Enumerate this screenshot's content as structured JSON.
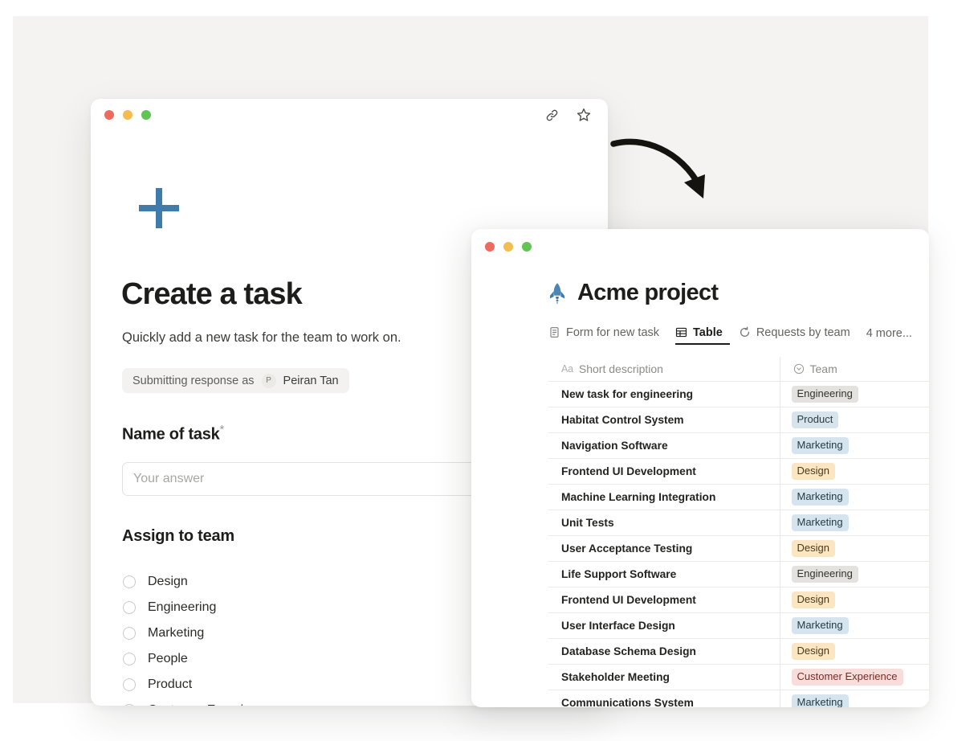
{
  "form_window": {
    "traffic_lights": [
      "close",
      "minimize",
      "maximize"
    ],
    "actions": [
      {
        "name": "link-icon",
        "label": "Copy link"
      },
      {
        "name": "star-icon",
        "label": "Favorite"
      }
    ],
    "plus_label": "+",
    "title": "Create a task",
    "subtitle": "Quickly add a new task for the team to work on.",
    "submitting": {
      "prefix": "Submitting response as",
      "avatar_initial": "P",
      "user_name": "Peiran Tan"
    },
    "fields": [
      {
        "label": "Name of task",
        "required_mark": "*",
        "input_placeholder": "Your answer",
        "input_value": ""
      },
      {
        "label": "Assign to team",
        "required_mark": "",
        "options": [
          "Design",
          "Engineering",
          "Marketing",
          "People",
          "Product",
          "Customer Experience"
        ]
      }
    ]
  },
  "annotation": {
    "arrow": "curved-arrow-down-right"
  },
  "acme_window": {
    "traffic_lights": [
      "close",
      "minimize",
      "maximize"
    ],
    "icon": "rocket-icon",
    "title": "Acme project",
    "tabs": [
      {
        "label": "Form for new task",
        "icon": "form-icon",
        "active": false
      },
      {
        "label": "Table",
        "icon": "table-icon",
        "active": true
      },
      {
        "label": "Requests by team",
        "icon": "chart-refresh-icon",
        "active": false
      }
    ],
    "tabs_overflow": "4 more...",
    "table": {
      "columns": [
        {
          "label": "Short description",
          "type_icon": "Aa"
        },
        {
          "label": "Team",
          "type_icon": "select-icon"
        }
      ],
      "rows": [
        {
          "description": "New task for engineering",
          "team": "Engineering",
          "team_class": "tag-engineering"
        },
        {
          "description": "Habitat Control System",
          "team": "Product",
          "team_class": "tag-product"
        },
        {
          "description": "Navigation Software",
          "team": "Marketing",
          "team_class": "tag-marketing"
        },
        {
          "description": "Frontend UI Development",
          "team": "Design",
          "team_class": "tag-design"
        },
        {
          "description": "Machine Learning Integration",
          "team": "Marketing",
          "team_class": "tag-marketing"
        },
        {
          "description": "Unit Tests",
          "team": "Marketing",
          "team_class": "tag-marketing"
        },
        {
          "description": "User Acceptance Testing",
          "team": "Design",
          "team_class": "tag-design"
        },
        {
          "description": "Life Support Software",
          "team": "Engineering",
          "team_class": "tag-engineering"
        },
        {
          "description": "Frontend UI Development",
          "team": "Design",
          "team_class": "tag-design"
        },
        {
          "description": "User Interface Design",
          "team": "Marketing",
          "team_class": "tag-marketing"
        },
        {
          "description": "Database Schema Design",
          "team": "Design",
          "team_class": "tag-design"
        },
        {
          "description": "Stakeholder Meeting",
          "team": "Customer Experience",
          "team_class": "tag-customer-experience"
        },
        {
          "description": "Communications System",
          "team": "Marketing",
          "team_class": "tag-marketing"
        }
      ]
    }
  },
  "colors": {
    "page_background": "#ffffff",
    "panel_background": "#f4f3f1",
    "accent_blue": "#3f7cac",
    "text_primary": "#1d1d1b",
    "text_muted": "#8c8c87",
    "border": "#eceae7"
  }
}
